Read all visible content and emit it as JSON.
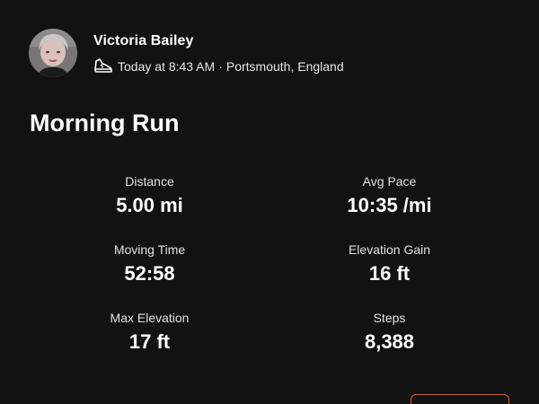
{
  "athlete": {
    "name": "Victoria Bailey",
    "avatar_icon": "avatar-photo"
  },
  "activity": {
    "type_icon": "running-shoe-icon",
    "datetime": "Today at 8:43 AM",
    "separator": "·",
    "location": "Portsmouth, England",
    "title": "Morning Run"
  },
  "stats": [
    {
      "label": "Distance",
      "value": "5.00 mi"
    },
    {
      "label": "Avg Pace",
      "value": "10:35 /mi"
    },
    {
      "label": "Moving Time",
      "value": "52:58"
    },
    {
      "label": "Elevation Gain",
      "value": "16 ft"
    },
    {
      "label": "Max Elevation",
      "value": "17 ft"
    },
    {
      "label": "Steps",
      "value": "8,388"
    }
  ],
  "colors": {
    "background": "#121212",
    "accent": "#fc5200",
    "text": "#ffffff"
  }
}
